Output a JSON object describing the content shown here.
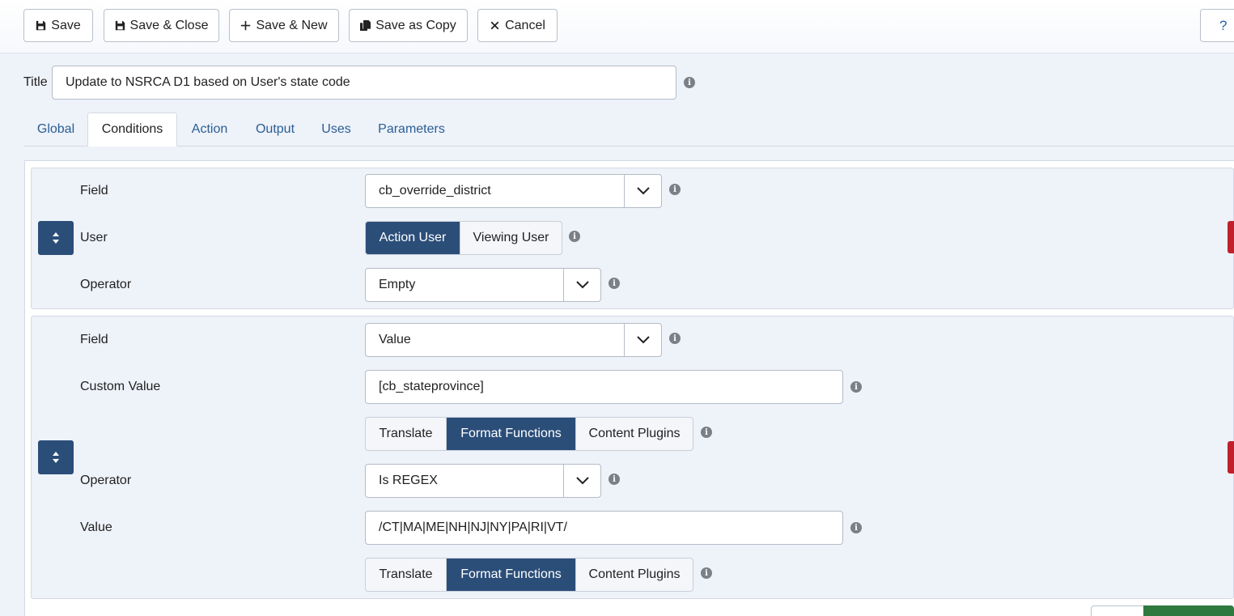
{
  "toolbar": {
    "save": "Save",
    "save_close": "Save & Close",
    "save_new": "Save & New",
    "save_copy": "Save as Copy",
    "cancel": "Cancel",
    "help": "?"
  },
  "title": {
    "label": "Title",
    "value": "Update to NSRCA D1 based on User's state code"
  },
  "tabs": [
    {
      "label": "Global"
    },
    {
      "label": "Conditions"
    },
    {
      "label": "Action"
    },
    {
      "label": "Output"
    },
    {
      "label": "Uses"
    },
    {
      "label": "Parameters"
    }
  ],
  "active_tab": "Conditions",
  "condition1": {
    "field_label": "Field",
    "field_value": "cb_override_district",
    "user_label": "User",
    "user_options": [
      "Action User",
      "Viewing User"
    ],
    "user_selected": "Action User",
    "operator_label": "Operator",
    "operator_value": "Empty"
  },
  "condition2": {
    "field_label": "Field",
    "field_value": "Value",
    "custom_value_label": "Custom Value",
    "custom_value": "[cb_stateprovince]",
    "custom_value_options": [
      "Translate",
      "Format Functions",
      "Content Plugins"
    ],
    "custom_value_selected": "Format Functions",
    "operator_label": "Operator",
    "operator_value": "Is REGEX",
    "value_label": "Value",
    "value": "/CT|MA|ME|NH|NJ|NY|PA|RI|VT/",
    "value_options": [
      "Translate",
      "Format Functions",
      "Content Plugins"
    ],
    "value_selected": "Format Functions"
  },
  "colors": {
    "accent": "#2b4e79",
    "link": "#2a5e94",
    "danger": "#c0202b",
    "success": "#2e7a3e",
    "background": "#eef2f9"
  }
}
